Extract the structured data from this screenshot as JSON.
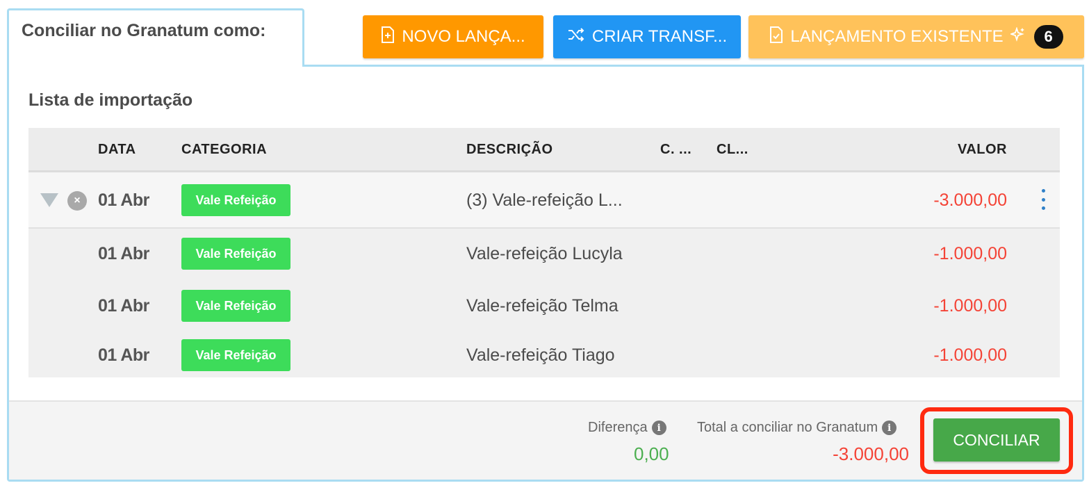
{
  "header": {
    "tab_title": "Conciliar no Granatum como:",
    "buttons": {
      "novo": {
        "label": "NOVO LANÇA...",
        "icon": "file-plus-icon"
      },
      "transferencia": {
        "label": "CRIAR TRANSF...",
        "icon": "shuffle-icon"
      },
      "existente": {
        "label": "LANÇAMENTO EXISTENTE",
        "icon": "file-check-icon",
        "sparkle_icon": "sparkle-icon",
        "badge": "6"
      }
    }
  },
  "section_title": "Lista de importação",
  "table": {
    "columns": {
      "data": "DATA",
      "categoria": "CATEGORIA",
      "descricao": "DESCRIÇÃO",
      "c": "C. ...",
      "cl": "CL...",
      "valor": "VALOR"
    },
    "main_row": {
      "date": "01 Abr",
      "category": "Vale Refeição",
      "description": "(3) Vale-refeição L...",
      "value": "-3.000,00"
    },
    "sub_rows": [
      {
        "date": "01 Abr",
        "category": "Vale Refeição",
        "description": "Vale-refeição Lucyla",
        "value": "-1.000,00"
      },
      {
        "date": "01 Abr",
        "category": "Vale Refeição",
        "description": "Vale-refeição Telma",
        "value": "-1.000,00"
      },
      {
        "date": "01 Abr",
        "category": "Vale Refeição",
        "description": "Vale-refeição Tiago",
        "value": "-1.000,00"
      }
    ]
  },
  "footer": {
    "diferenca_label": "Diferença",
    "diferenca_value": "0,00",
    "total_label": "Total a conciliar no Granatum",
    "total_value": "-3.000,00",
    "conciliar_label": "CONCILIAR"
  },
  "colors": {
    "orange": "#ff9800",
    "blue": "#2196f3",
    "light_orange": "#ffc25a",
    "green_tag": "#3ddc5a",
    "green_button": "#47a849",
    "negative": "#f44336",
    "positive": "#4caf50",
    "highlight": "#ff2a10"
  }
}
